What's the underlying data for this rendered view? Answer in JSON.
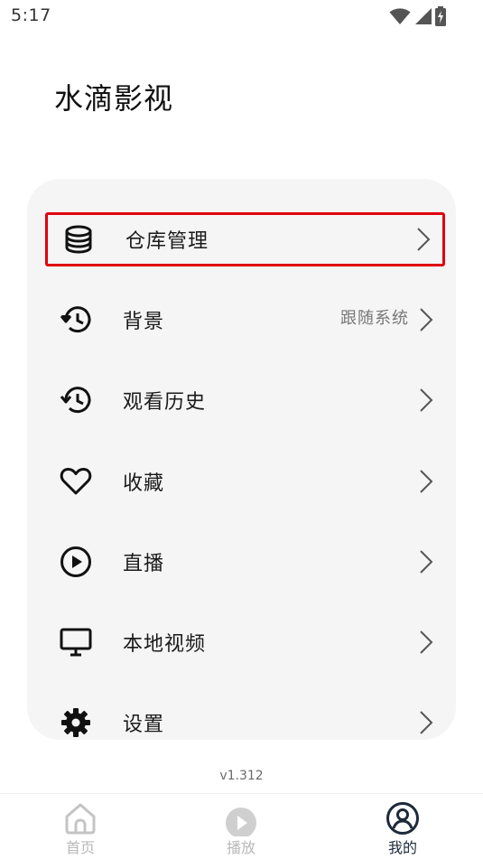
{
  "status_bar": {
    "time": "5:17",
    "icons": [
      "wifi-icon",
      "signal-icon",
      "battery-charging-icon"
    ]
  },
  "app_title": "水滴影视",
  "menu": {
    "items": [
      {
        "icon": "database-icon",
        "label": "仓库管理",
        "value": "",
        "highlighted": true
      },
      {
        "icon": "history-icon",
        "label": "背景",
        "value": "跟随系统"
      },
      {
        "icon": "history-icon",
        "label": "观看历史",
        "value": ""
      },
      {
        "icon": "heart-icon",
        "label": "收藏",
        "value": ""
      },
      {
        "icon": "play-circle-icon",
        "label": "直播",
        "value": ""
      },
      {
        "icon": "monitor-icon",
        "label": "本地视频",
        "value": ""
      },
      {
        "icon": "gear-icon",
        "label": "设置",
        "value": ""
      }
    ]
  },
  "version": "v1.312",
  "bottom_nav": {
    "items": [
      {
        "icon": "home-icon",
        "label": "首页",
        "active": false
      },
      {
        "icon": "play-icon",
        "label": "播放",
        "active": false
      },
      {
        "icon": "user-circle-icon",
        "label": "我的",
        "active": true
      }
    ]
  },
  "colors": {
    "highlight_border": "#e0000f",
    "card_background": "#f5f5f5",
    "nav_active": "#1e2a3a",
    "nav_inactive": "#b8b8b8"
  }
}
